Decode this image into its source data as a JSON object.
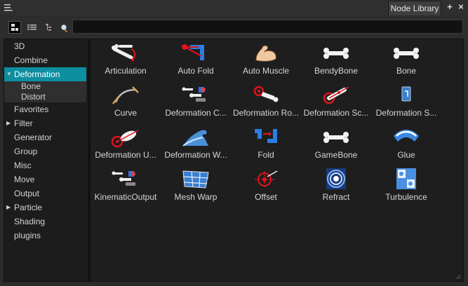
{
  "window": {
    "tab_label": "Node Library",
    "add_label": "+",
    "close_label": "×"
  },
  "toolbar": {
    "tools": [
      {
        "name": "large-icons-view-icon",
        "active": true
      },
      {
        "name": "list-view-icon",
        "active": false
      },
      {
        "name": "tree-view-icon",
        "active": false
      }
    ],
    "search_value": ""
  },
  "sidebar": {
    "categories": [
      {
        "label": "3D"
      },
      {
        "label": "Combine"
      },
      {
        "label": "Deformation"
      },
      {
        "label": "Bone"
      },
      {
        "label": "Distort"
      },
      {
        "label": "Favorites"
      },
      {
        "label": "Filter"
      },
      {
        "label": "Generator"
      },
      {
        "label": "Group"
      },
      {
        "label": "Misc"
      },
      {
        "label": "Move"
      },
      {
        "label": "Output"
      },
      {
        "label": "Particle"
      },
      {
        "label": "Shading"
      },
      {
        "label": "plugins"
      }
    ]
  },
  "nodes": [
    {
      "label": "Articulation",
      "icon": "articulation-icon"
    },
    {
      "label": "Auto Fold",
      "icon": "auto-fold-icon"
    },
    {
      "label": "Auto Muscle",
      "icon": "auto-muscle-icon"
    },
    {
      "label": "BendyBone",
      "icon": "bendy-bone-icon"
    },
    {
      "label": "Bone",
      "icon": "bone-icon"
    },
    {
      "label": "Curve",
      "icon": "curve-icon"
    },
    {
      "label": "Deformation C...",
      "icon": "deformation-composite-icon"
    },
    {
      "label": "Deformation Ro...",
      "icon": "deformation-root-icon"
    },
    {
      "label": "Deformation Sc...",
      "icon": "deformation-scale-icon"
    },
    {
      "label": "Deformation S...",
      "icon": "deformation-switch-icon"
    },
    {
      "label": "Deformation U...",
      "icon": "deformation-uniform-scale-icon"
    },
    {
      "label": "Deformation W...",
      "icon": "deformation-wave-icon"
    },
    {
      "label": "Fold",
      "icon": "fold-icon"
    },
    {
      "label": "GameBone",
      "icon": "game-bone-icon"
    },
    {
      "label": "Glue",
      "icon": "glue-icon"
    },
    {
      "label": "KinematicOutput",
      "icon": "kinematic-output-icon"
    },
    {
      "label": "Mesh Warp",
      "icon": "mesh-warp-icon"
    },
    {
      "label": "Offset",
      "icon": "offset-icon"
    },
    {
      "label": "Refract",
      "icon": "refract-icon"
    },
    {
      "label": "Turbulence",
      "icon": "turbulence-icon"
    }
  ],
  "colors": {
    "selection": "#0e8fa0",
    "accent_red": "#e0141c",
    "accent_blue": "#2a7de1"
  }
}
